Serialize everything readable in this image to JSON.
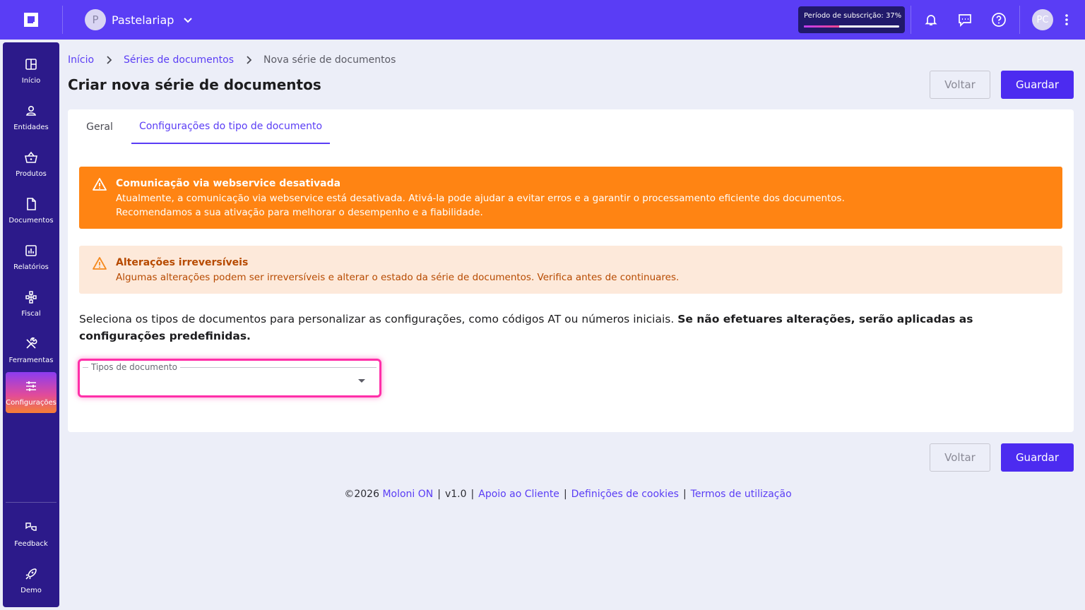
{
  "topbar": {
    "logo_icon": "moloni-logo-icon",
    "company": {
      "avatar_letter": "P",
      "name": "Pastelariap"
    },
    "subscription": {
      "label": "Período de subscrição: 37%",
      "progress_percent": 37
    },
    "icons": [
      "bell-icon",
      "chat-icon",
      "help-icon"
    ],
    "user_initials": "PC"
  },
  "sidebar": {
    "items": [
      {
        "label": "Início",
        "icon": "dashboard-icon"
      },
      {
        "label": "Entidades",
        "icon": "person-icon"
      },
      {
        "label": "Produtos",
        "icon": "basket-icon"
      },
      {
        "label": "Documentos",
        "icon": "document-icon"
      },
      {
        "label": "Relatórios",
        "icon": "chart-icon"
      },
      {
        "label": "Fiscal",
        "icon": "fiscal-icon"
      },
      {
        "label": "Ferramentas",
        "icon": "tools-icon"
      },
      {
        "label": "Configurações",
        "icon": "sliders-icon",
        "active": true
      }
    ],
    "bottom_items": [
      {
        "label": "Feedback",
        "icon": "feedback-icon"
      },
      {
        "label": "Demo",
        "icon": "rocket-icon"
      }
    ]
  },
  "breadcrumb": {
    "home": "Início",
    "series": "Séries de documentos",
    "current": "Nova série de documentos"
  },
  "page": {
    "title": "Criar nova série de documentos",
    "back_label": "Voltar",
    "save_label": "Guardar"
  },
  "tabs": {
    "general": "Geral",
    "config": "Configurações do tipo de documento",
    "active": "config"
  },
  "alerts": {
    "webservice": {
      "title": "Comunicação via webservice desativada",
      "line1": "Atualmente, a comunicação via webservice está desativada. Ativá-la pode ajudar a evitar erros e a garantir o processamento eficiente dos documentos.",
      "line2": "Recomendamos a sua ativação para melhorar o desempenho e a fiabilidade."
    },
    "irreversible": {
      "title": "Alterações irreversíveis",
      "text": "Algumas alterações podem ser irreversíveis e alterar o estado da série de documentos. Verifica antes de continuares."
    }
  },
  "intro": {
    "text": "Seleciona os tipos de documentos para personalizar as configurações, como códigos AT ou números iniciais. ",
    "bold": "Se não efetuares alterações, serão aplicadas as configurações predefinidas."
  },
  "select": {
    "label": "Tipos de documento",
    "value": ""
  },
  "colors": {
    "brand": "#5a3df5",
    "sidebar": "#2c1a8a",
    "warning": "#ff8413",
    "caution_bg": "#fde9da",
    "focus": "#ff2fa8"
  },
  "footer": {
    "copyright": "©2026",
    "product": "Moloni ON",
    "version": "v1.0",
    "support": "Apoio ao Cliente",
    "cookies": "Definições de cookies",
    "terms": "Termos de utilização"
  }
}
